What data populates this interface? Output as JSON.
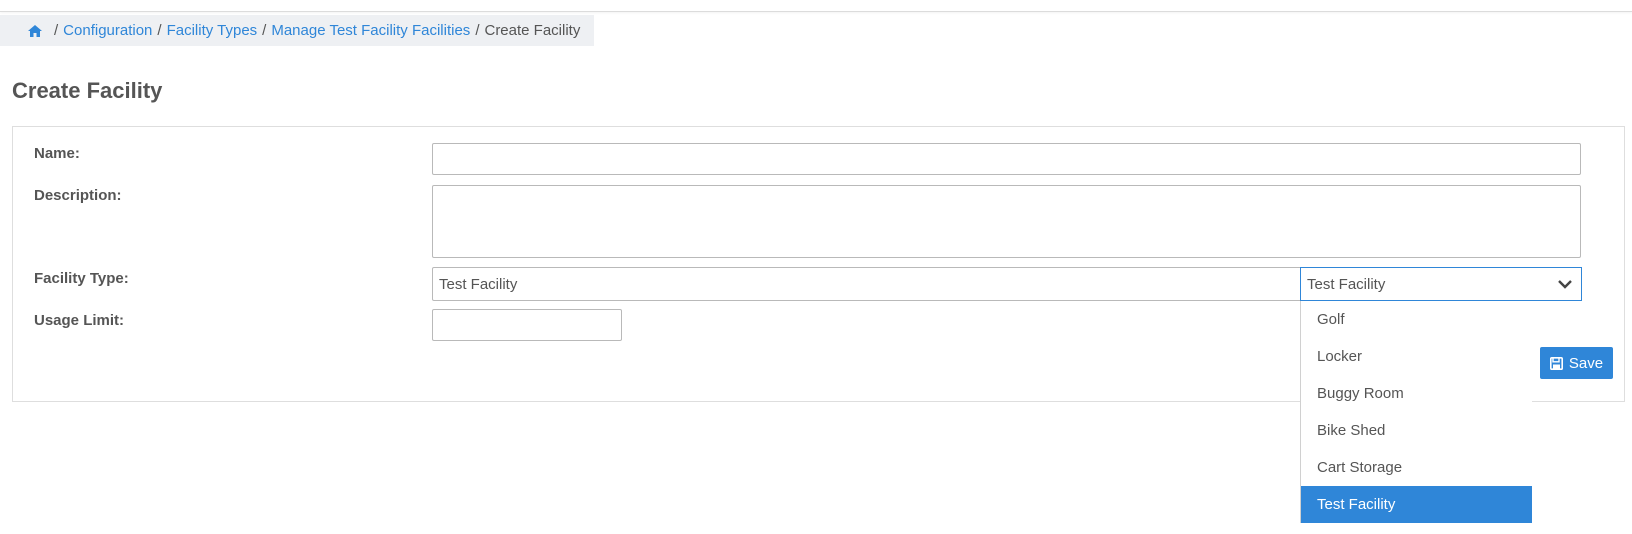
{
  "breadcrumb": {
    "home_icon": "home-icon",
    "items": [
      "Configuration",
      "Facility Types",
      "Manage Test Facility Facilities"
    ],
    "current": "Create Facility"
  },
  "page": {
    "title": "Create Facility"
  },
  "form": {
    "name_label": "Name:",
    "name_value": "",
    "description_label": "Description:",
    "description_value": "",
    "facility_type_label": "Facility Type:",
    "facility_type_value": "Test Facility",
    "facility_type_combo_value": "Test Facility",
    "facility_type_options": [
      "Golf",
      "Locker",
      "Buggy Room",
      "Bike Shed",
      "Cart Storage",
      "Test Facility"
    ],
    "facility_type_selected": "Test Facility",
    "usage_limit_label": "Usage Limit:",
    "usage_limit_value": "",
    "save_label": "Save",
    "save_icon": "floppy-disk-icon"
  },
  "colors": {
    "accent": "#2f86d8",
    "text": "#555555",
    "breadcrumb_bg": "#eef0f3"
  }
}
